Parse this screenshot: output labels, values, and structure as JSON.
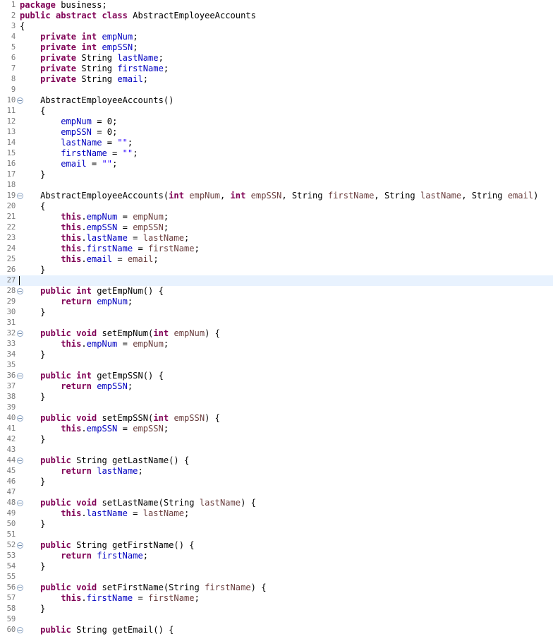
{
  "editor": {
    "name": "java-source-editor",
    "file_class": "AbstractEmployeeAccounts",
    "package": "business",
    "current_line": 27,
    "first_line": 1,
    "last_line": 60,
    "colors": {
      "background": "#ffffff",
      "keyword": "#7f0055",
      "field": "#0000c0",
      "parameter": "#6a3e3e",
      "string": "#2a00ff",
      "plain": "#000000",
      "line_number": "#787878",
      "current_line_highlight": "#e8f2fe",
      "fold_marker": "#8fa8c8"
    },
    "icons": {
      "fold": "collapse-fold-icon"
    }
  },
  "lines": [
    {
      "n": 1,
      "fold": false,
      "tokens": [
        {
          "t": "package",
          "c": "kw"
        },
        {
          "t": " business;",
          "c": "pln"
        }
      ]
    },
    {
      "n": 2,
      "fold": false,
      "tokens": [
        {
          "t": "public abstract class",
          "c": "kw"
        },
        {
          "t": " AbstractEmployeeAccounts",
          "c": "pln"
        }
      ]
    },
    {
      "n": 3,
      "fold": false,
      "tokens": [
        {
          "t": "{",
          "c": "pln"
        }
      ]
    },
    {
      "n": 4,
      "fold": false,
      "tokens": [
        {
          "t": "    ",
          "c": "pln"
        },
        {
          "t": "private int",
          "c": "kw"
        },
        {
          "t": " ",
          "c": "pln"
        },
        {
          "t": "empNum",
          "c": "fld"
        },
        {
          "t": ";",
          "c": "pln"
        }
      ]
    },
    {
      "n": 5,
      "fold": false,
      "tokens": [
        {
          "t": "    ",
          "c": "pln"
        },
        {
          "t": "private int",
          "c": "kw"
        },
        {
          "t": " ",
          "c": "pln"
        },
        {
          "t": "empSSN",
          "c": "fld"
        },
        {
          "t": ";",
          "c": "pln"
        }
      ]
    },
    {
      "n": 6,
      "fold": false,
      "tokens": [
        {
          "t": "    ",
          "c": "pln"
        },
        {
          "t": "private",
          "c": "kw"
        },
        {
          "t": " String ",
          "c": "pln"
        },
        {
          "t": "lastName",
          "c": "fld"
        },
        {
          "t": ";",
          "c": "pln"
        }
      ]
    },
    {
      "n": 7,
      "fold": false,
      "tokens": [
        {
          "t": "    ",
          "c": "pln"
        },
        {
          "t": "private",
          "c": "kw"
        },
        {
          "t": " String ",
          "c": "pln"
        },
        {
          "t": "firstName",
          "c": "fld"
        },
        {
          "t": ";",
          "c": "pln"
        }
      ]
    },
    {
      "n": 8,
      "fold": false,
      "tokens": [
        {
          "t": "    ",
          "c": "pln"
        },
        {
          "t": "private",
          "c": "kw"
        },
        {
          "t": " String ",
          "c": "pln"
        },
        {
          "t": "email",
          "c": "fld"
        },
        {
          "t": ";",
          "c": "pln"
        }
      ]
    },
    {
      "n": 9,
      "fold": false,
      "tokens": []
    },
    {
      "n": 10,
      "fold": true,
      "tokens": [
        {
          "t": "    AbstractEmployeeAccounts()",
          "c": "pln"
        }
      ]
    },
    {
      "n": 11,
      "fold": false,
      "tokens": [
        {
          "t": "    {",
          "c": "pln"
        }
      ]
    },
    {
      "n": 12,
      "fold": false,
      "tokens": [
        {
          "t": "        ",
          "c": "pln"
        },
        {
          "t": "empNum",
          "c": "fld"
        },
        {
          "t": " = ",
          "c": "pln"
        },
        {
          "t": "0",
          "c": "num"
        },
        {
          "t": ";",
          "c": "pln"
        }
      ]
    },
    {
      "n": 13,
      "fold": false,
      "tokens": [
        {
          "t": "        ",
          "c": "pln"
        },
        {
          "t": "empSSN",
          "c": "fld"
        },
        {
          "t": " = ",
          "c": "pln"
        },
        {
          "t": "0",
          "c": "num"
        },
        {
          "t": ";",
          "c": "pln"
        }
      ]
    },
    {
      "n": 14,
      "fold": false,
      "tokens": [
        {
          "t": "        ",
          "c": "pln"
        },
        {
          "t": "lastName",
          "c": "fld"
        },
        {
          "t": " = ",
          "c": "pln"
        },
        {
          "t": "\"\"",
          "c": "str"
        },
        {
          "t": ";",
          "c": "pln"
        }
      ]
    },
    {
      "n": 15,
      "fold": false,
      "tokens": [
        {
          "t": "        ",
          "c": "pln"
        },
        {
          "t": "firstName",
          "c": "fld"
        },
        {
          "t": " = ",
          "c": "pln"
        },
        {
          "t": "\"\"",
          "c": "str"
        },
        {
          "t": ";",
          "c": "pln"
        }
      ]
    },
    {
      "n": 16,
      "fold": false,
      "tokens": [
        {
          "t": "        ",
          "c": "pln"
        },
        {
          "t": "email",
          "c": "fld"
        },
        {
          "t": " = ",
          "c": "pln"
        },
        {
          "t": "\"\"",
          "c": "str"
        },
        {
          "t": ";",
          "c": "pln"
        }
      ]
    },
    {
      "n": 17,
      "fold": false,
      "tokens": [
        {
          "t": "    }",
          "c": "pln"
        }
      ]
    },
    {
      "n": 18,
      "fold": false,
      "tokens": []
    },
    {
      "n": 19,
      "fold": true,
      "tokens": [
        {
          "t": "    AbstractEmployeeAccounts(",
          "c": "pln"
        },
        {
          "t": "int",
          "c": "kw"
        },
        {
          "t": " ",
          "c": "pln"
        },
        {
          "t": "empNum",
          "c": "par"
        },
        {
          "t": ", ",
          "c": "pln"
        },
        {
          "t": "int",
          "c": "kw"
        },
        {
          "t": " ",
          "c": "pln"
        },
        {
          "t": "empSSN",
          "c": "par"
        },
        {
          "t": ", String ",
          "c": "pln"
        },
        {
          "t": "firstName",
          "c": "par"
        },
        {
          "t": ", String ",
          "c": "pln"
        },
        {
          "t": "lastName",
          "c": "par"
        },
        {
          "t": ", String ",
          "c": "pln"
        },
        {
          "t": "email",
          "c": "par"
        },
        {
          "t": ")",
          "c": "pln"
        }
      ]
    },
    {
      "n": 20,
      "fold": false,
      "tokens": [
        {
          "t": "    {",
          "c": "pln"
        }
      ]
    },
    {
      "n": 21,
      "fold": false,
      "tokens": [
        {
          "t": "        ",
          "c": "pln"
        },
        {
          "t": "this",
          "c": "kw"
        },
        {
          "t": ".",
          "c": "pln"
        },
        {
          "t": "empNum",
          "c": "fld"
        },
        {
          "t": " = ",
          "c": "pln"
        },
        {
          "t": "empNum",
          "c": "par"
        },
        {
          "t": ";",
          "c": "pln"
        }
      ]
    },
    {
      "n": 22,
      "fold": false,
      "tokens": [
        {
          "t": "        ",
          "c": "pln"
        },
        {
          "t": "this",
          "c": "kw"
        },
        {
          "t": ".",
          "c": "pln"
        },
        {
          "t": "empSSN",
          "c": "fld"
        },
        {
          "t": " = ",
          "c": "pln"
        },
        {
          "t": "empSSN",
          "c": "par"
        },
        {
          "t": ";",
          "c": "pln"
        }
      ]
    },
    {
      "n": 23,
      "fold": false,
      "tokens": [
        {
          "t": "        ",
          "c": "pln"
        },
        {
          "t": "this",
          "c": "kw"
        },
        {
          "t": ".",
          "c": "pln"
        },
        {
          "t": "lastName",
          "c": "fld"
        },
        {
          "t": " = ",
          "c": "pln"
        },
        {
          "t": "lastName",
          "c": "par"
        },
        {
          "t": ";",
          "c": "pln"
        }
      ]
    },
    {
      "n": 24,
      "fold": false,
      "tokens": [
        {
          "t": "        ",
          "c": "pln"
        },
        {
          "t": "this",
          "c": "kw"
        },
        {
          "t": ".",
          "c": "pln"
        },
        {
          "t": "firstName",
          "c": "fld"
        },
        {
          "t": " = ",
          "c": "pln"
        },
        {
          "t": "firstName",
          "c": "par"
        },
        {
          "t": ";",
          "c": "pln"
        }
      ]
    },
    {
      "n": 25,
      "fold": false,
      "tokens": [
        {
          "t": "        ",
          "c": "pln"
        },
        {
          "t": "this",
          "c": "kw"
        },
        {
          "t": ".",
          "c": "pln"
        },
        {
          "t": "email",
          "c": "fld"
        },
        {
          "t": " = ",
          "c": "pln"
        },
        {
          "t": "email",
          "c": "par"
        },
        {
          "t": ";",
          "c": "pln"
        }
      ]
    },
    {
      "n": 26,
      "fold": false,
      "tokens": [
        {
          "t": "    }",
          "c": "pln"
        }
      ]
    },
    {
      "n": 27,
      "fold": false,
      "current": true,
      "tokens": []
    },
    {
      "n": 28,
      "fold": true,
      "tokens": [
        {
          "t": "    ",
          "c": "pln"
        },
        {
          "t": "public int",
          "c": "kw"
        },
        {
          "t": " getEmpNum() {",
          "c": "pln"
        }
      ]
    },
    {
      "n": 29,
      "fold": false,
      "tokens": [
        {
          "t": "        ",
          "c": "pln"
        },
        {
          "t": "return",
          "c": "kw"
        },
        {
          "t": " ",
          "c": "pln"
        },
        {
          "t": "empNum",
          "c": "fld"
        },
        {
          "t": ";",
          "c": "pln"
        }
      ]
    },
    {
      "n": 30,
      "fold": false,
      "tokens": [
        {
          "t": "    }",
          "c": "pln"
        }
      ]
    },
    {
      "n": 31,
      "fold": false,
      "tokens": []
    },
    {
      "n": 32,
      "fold": true,
      "tokens": [
        {
          "t": "    ",
          "c": "pln"
        },
        {
          "t": "public void",
          "c": "kw"
        },
        {
          "t": " setEmpNum(",
          "c": "pln"
        },
        {
          "t": "int",
          "c": "kw"
        },
        {
          "t": " ",
          "c": "pln"
        },
        {
          "t": "empNum",
          "c": "par"
        },
        {
          "t": ") {",
          "c": "pln"
        }
      ]
    },
    {
      "n": 33,
      "fold": false,
      "tokens": [
        {
          "t": "        ",
          "c": "pln"
        },
        {
          "t": "this",
          "c": "kw"
        },
        {
          "t": ".",
          "c": "pln"
        },
        {
          "t": "empNum",
          "c": "fld"
        },
        {
          "t": " = ",
          "c": "pln"
        },
        {
          "t": "empNum",
          "c": "par"
        },
        {
          "t": ";",
          "c": "pln"
        }
      ]
    },
    {
      "n": 34,
      "fold": false,
      "tokens": [
        {
          "t": "    }",
          "c": "pln"
        }
      ]
    },
    {
      "n": 35,
      "fold": false,
      "tokens": []
    },
    {
      "n": 36,
      "fold": true,
      "tokens": [
        {
          "t": "    ",
          "c": "pln"
        },
        {
          "t": "public int",
          "c": "kw"
        },
        {
          "t": " getEmpSSN() {",
          "c": "pln"
        }
      ]
    },
    {
      "n": 37,
      "fold": false,
      "tokens": [
        {
          "t": "        ",
          "c": "pln"
        },
        {
          "t": "return",
          "c": "kw"
        },
        {
          "t": " ",
          "c": "pln"
        },
        {
          "t": "empSSN",
          "c": "fld"
        },
        {
          "t": ";",
          "c": "pln"
        }
      ]
    },
    {
      "n": 38,
      "fold": false,
      "tokens": [
        {
          "t": "    }",
          "c": "pln"
        }
      ]
    },
    {
      "n": 39,
      "fold": false,
      "tokens": []
    },
    {
      "n": 40,
      "fold": true,
      "tokens": [
        {
          "t": "    ",
          "c": "pln"
        },
        {
          "t": "public void",
          "c": "kw"
        },
        {
          "t": " setEmpSSN(",
          "c": "pln"
        },
        {
          "t": "int",
          "c": "kw"
        },
        {
          "t": " ",
          "c": "pln"
        },
        {
          "t": "empSSN",
          "c": "par"
        },
        {
          "t": ") {",
          "c": "pln"
        }
      ]
    },
    {
      "n": 41,
      "fold": false,
      "tokens": [
        {
          "t": "        ",
          "c": "pln"
        },
        {
          "t": "this",
          "c": "kw"
        },
        {
          "t": ".",
          "c": "pln"
        },
        {
          "t": "empSSN",
          "c": "fld"
        },
        {
          "t": " = ",
          "c": "pln"
        },
        {
          "t": "empSSN",
          "c": "par"
        },
        {
          "t": ";",
          "c": "pln"
        }
      ]
    },
    {
      "n": 42,
      "fold": false,
      "tokens": [
        {
          "t": "    }",
          "c": "pln"
        }
      ]
    },
    {
      "n": 43,
      "fold": false,
      "tokens": []
    },
    {
      "n": 44,
      "fold": true,
      "tokens": [
        {
          "t": "    ",
          "c": "pln"
        },
        {
          "t": "public",
          "c": "kw"
        },
        {
          "t": " String getLastName() {",
          "c": "pln"
        }
      ]
    },
    {
      "n": 45,
      "fold": false,
      "tokens": [
        {
          "t": "        ",
          "c": "pln"
        },
        {
          "t": "return",
          "c": "kw"
        },
        {
          "t": " ",
          "c": "pln"
        },
        {
          "t": "lastName",
          "c": "fld"
        },
        {
          "t": ";",
          "c": "pln"
        }
      ]
    },
    {
      "n": 46,
      "fold": false,
      "tokens": [
        {
          "t": "    }",
          "c": "pln"
        }
      ]
    },
    {
      "n": 47,
      "fold": false,
      "tokens": []
    },
    {
      "n": 48,
      "fold": true,
      "tokens": [
        {
          "t": "    ",
          "c": "pln"
        },
        {
          "t": "public void",
          "c": "kw"
        },
        {
          "t": " setLastName(String ",
          "c": "pln"
        },
        {
          "t": "lastName",
          "c": "par"
        },
        {
          "t": ") {",
          "c": "pln"
        }
      ]
    },
    {
      "n": 49,
      "fold": false,
      "tokens": [
        {
          "t": "        ",
          "c": "pln"
        },
        {
          "t": "this",
          "c": "kw"
        },
        {
          "t": ".",
          "c": "pln"
        },
        {
          "t": "lastName",
          "c": "fld"
        },
        {
          "t": " = ",
          "c": "pln"
        },
        {
          "t": "lastName",
          "c": "par"
        },
        {
          "t": ";",
          "c": "pln"
        }
      ]
    },
    {
      "n": 50,
      "fold": false,
      "tokens": [
        {
          "t": "    }",
          "c": "pln"
        }
      ]
    },
    {
      "n": 51,
      "fold": false,
      "tokens": []
    },
    {
      "n": 52,
      "fold": true,
      "tokens": [
        {
          "t": "    ",
          "c": "pln"
        },
        {
          "t": "public",
          "c": "kw"
        },
        {
          "t": " String getFirstName() {",
          "c": "pln"
        }
      ]
    },
    {
      "n": 53,
      "fold": false,
      "tokens": [
        {
          "t": "        ",
          "c": "pln"
        },
        {
          "t": "return",
          "c": "kw"
        },
        {
          "t": " ",
          "c": "pln"
        },
        {
          "t": "firstName",
          "c": "fld"
        },
        {
          "t": ";",
          "c": "pln"
        }
      ]
    },
    {
      "n": 54,
      "fold": false,
      "tokens": [
        {
          "t": "    }",
          "c": "pln"
        }
      ]
    },
    {
      "n": 55,
      "fold": false,
      "tokens": []
    },
    {
      "n": 56,
      "fold": true,
      "tokens": [
        {
          "t": "    ",
          "c": "pln"
        },
        {
          "t": "public void",
          "c": "kw"
        },
        {
          "t": " setFirstName(String ",
          "c": "pln"
        },
        {
          "t": "firstName",
          "c": "par"
        },
        {
          "t": ") {",
          "c": "pln"
        }
      ]
    },
    {
      "n": 57,
      "fold": false,
      "tokens": [
        {
          "t": "        ",
          "c": "pln"
        },
        {
          "t": "this",
          "c": "kw"
        },
        {
          "t": ".",
          "c": "pln"
        },
        {
          "t": "firstName",
          "c": "fld"
        },
        {
          "t": " = ",
          "c": "pln"
        },
        {
          "t": "firstName",
          "c": "par"
        },
        {
          "t": ";",
          "c": "pln"
        }
      ]
    },
    {
      "n": 58,
      "fold": false,
      "tokens": [
        {
          "t": "    }",
          "c": "pln"
        }
      ]
    },
    {
      "n": 59,
      "fold": false,
      "tokens": []
    },
    {
      "n": 60,
      "fold": true,
      "tokens": [
        {
          "t": "    ",
          "c": "pln"
        },
        {
          "t": "public",
          "c": "kw"
        },
        {
          "t": " String getEmail() {",
          "c": "pln"
        }
      ]
    }
  ]
}
